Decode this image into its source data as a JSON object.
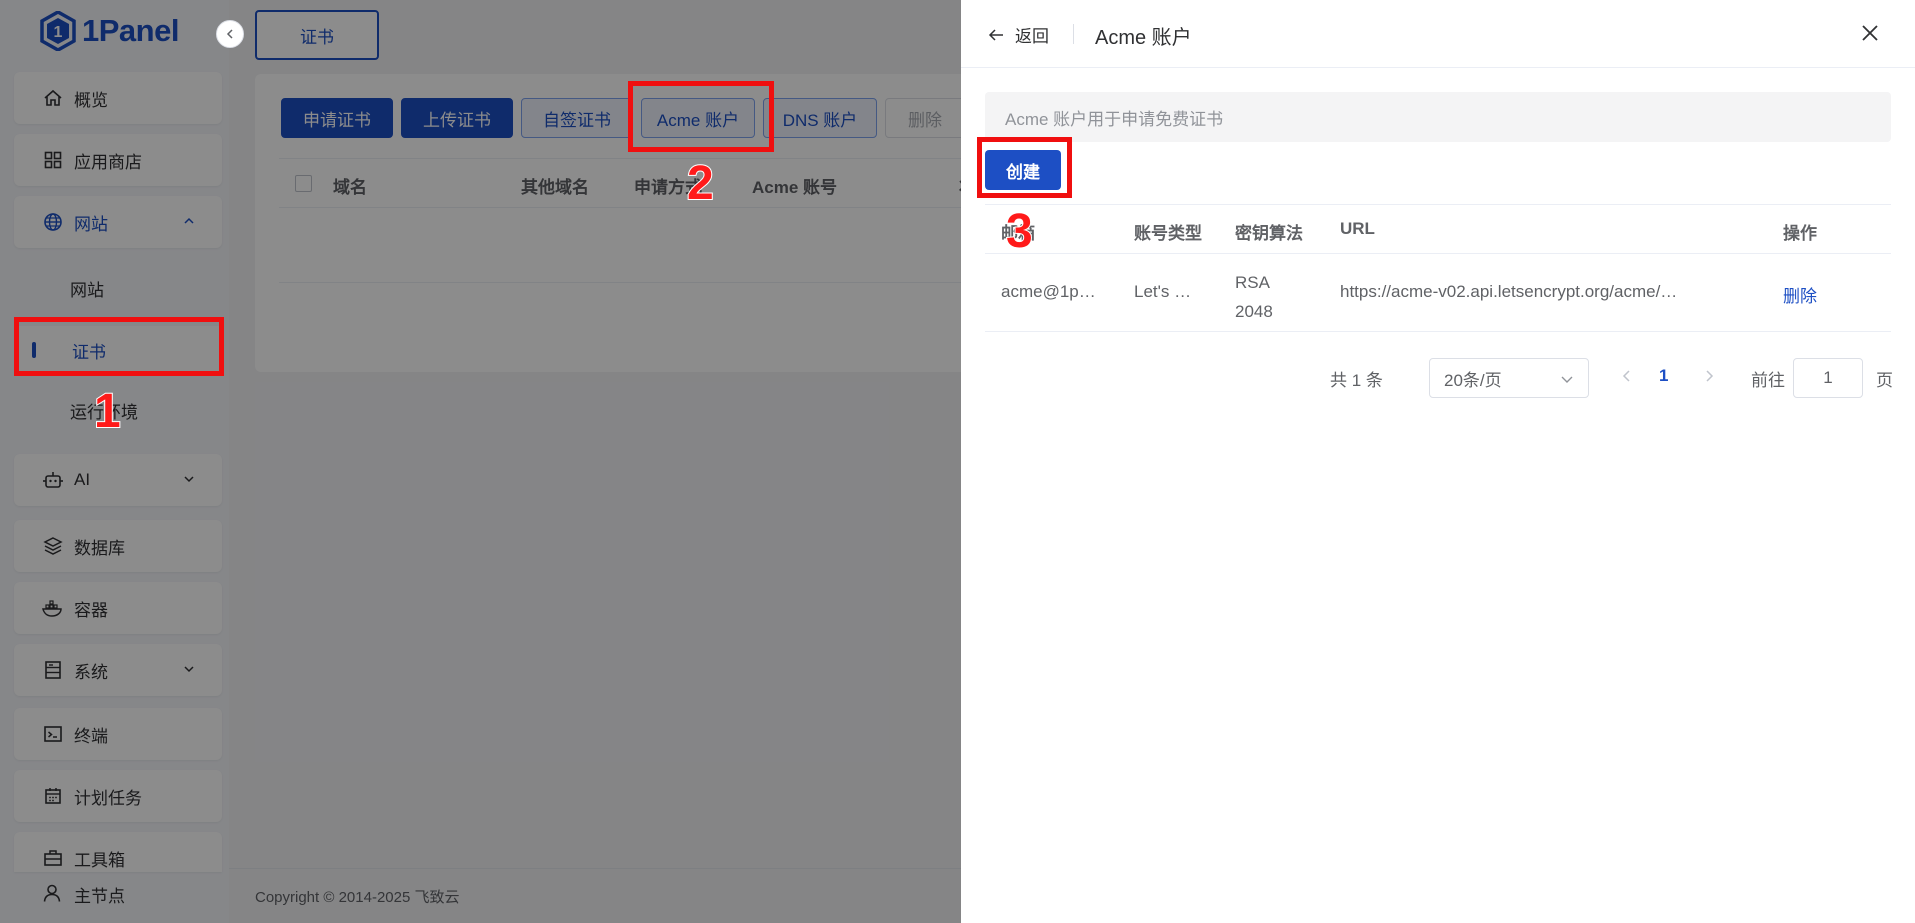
{
  "sidebar": {
    "logo_text": "1Panel",
    "items": [
      {
        "label": "概览",
        "icon": "home-icon"
      },
      {
        "label": "应用商店",
        "icon": "grid-icon"
      },
      {
        "label": "网站",
        "icon": "globe-icon",
        "expanded": true,
        "children": [
          {
            "label": "网站"
          },
          {
            "label": "证书",
            "selected": true
          },
          {
            "label": "运行环境"
          }
        ]
      },
      {
        "label": "AI",
        "icon": "robot-icon"
      },
      {
        "label": "数据库",
        "icon": "layers-icon"
      },
      {
        "label": "容器",
        "icon": "docker-icon"
      },
      {
        "label": "系统",
        "icon": "server-icon"
      },
      {
        "label": "终端",
        "icon": "terminal-icon"
      },
      {
        "label": "计划任务",
        "icon": "calendar-icon"
      },
      {
        "label": "工具箱",
        "icon": "toolbox-icon"
      }
    ],
    "bottom_item": {
      "label": "主节点",
      "icon": "user-icon"
    }
  },
  "main": {
    "tab": "证书",
    "buttons": {
      "apply": "申请证书",
      "upload": "上传证书",
      "self_signed": "自签证书",
      "acme": "Acme 账户",
      "dns": "DNS 账户",
      "delete": "删除"
    },
    "columns": [
      "域名",
      "其他域名",
      "申请方式",
      "Acme 账号",
      "状态"
    ],
    "footer": "Copyright © 2014-2025 飞致云"
  },
  "drawer": {
    "back_label": "返回",
    "title": "Acme 账户",
    "info_text": "Acme 账户用于申请免费证书",
    "create_label": "创建",
    "columns": [
      "邮箱",
      "账号类型",
      "密钥算法",
      "URL",
      "操作"
    ],
    "rows": [
      {
        "email": "acme@1p…",
        "type": "Let's …",
        "algo_line1": "RSA",
        "algo_line2": "2048",
        "url": "https://acme-v02.api.letsencrypt.org/acme/…",
        "action": "删除"
      }
    ],
    "pagination": {
      "total": "共 1 条",
      "page_size": "20条/页",
      "current_page": "1",
      "goto_label": "前往",
      "goto_value": "1",
      "page_suffix": "页"
    }
  },
  "annotations": {
    "step1": "1",
    "step2": "2",
    "step3": "3"
  },
  "colors": {
    "brand": "#1d4fc4",
    "highlight": "#f00f0f"
  }
}
